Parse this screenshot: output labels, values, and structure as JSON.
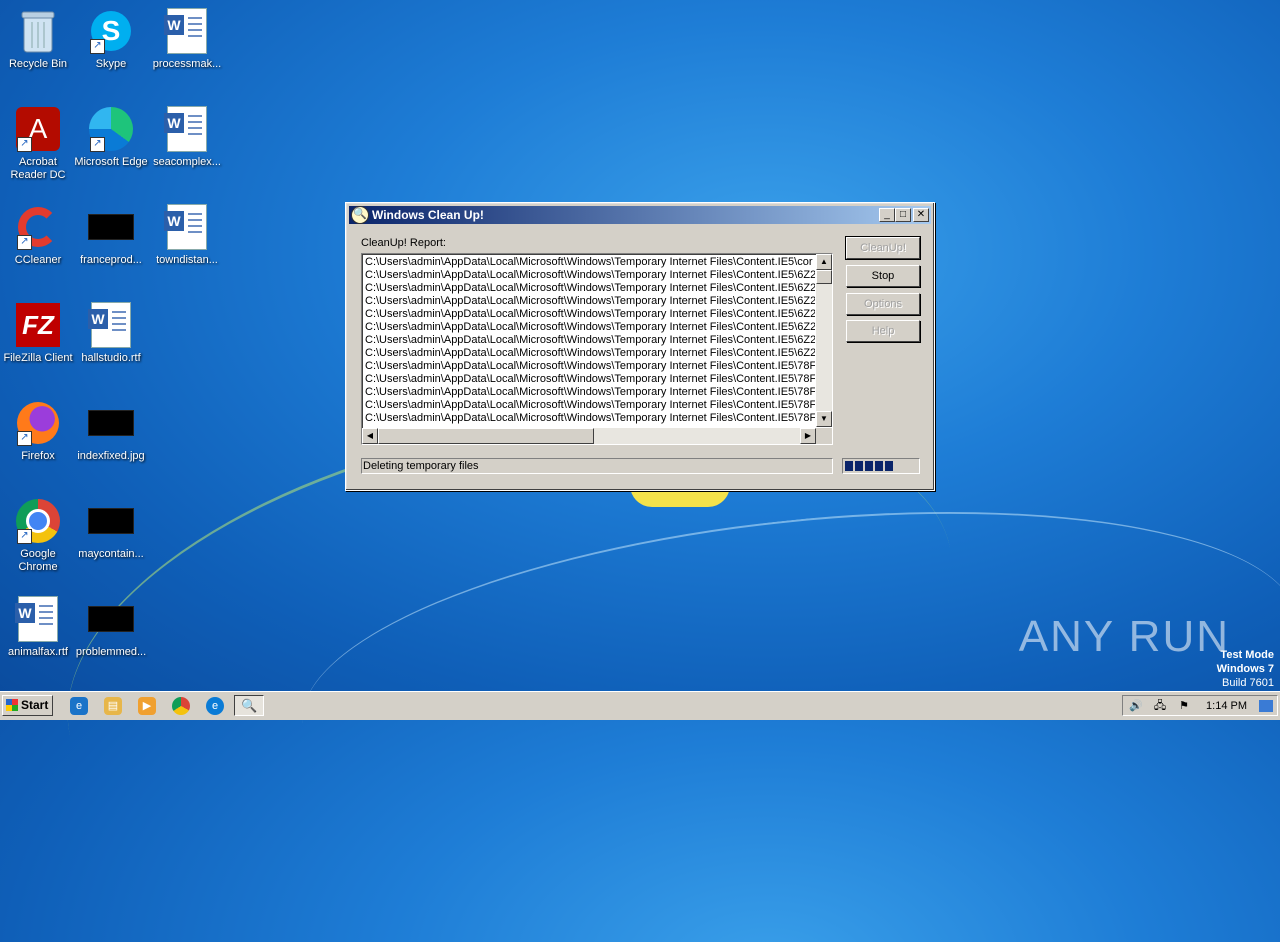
{
  "desktop": {
    "icons": [
      {
        "label": "Recycle Bin"
      },
      {
        "label": "Skype"
      },
      {
        "label": "processmak..."
      },
      {
        "label": "Acrobat Reader DC"
      },
      {
        "label": "Microsoft Edge"
      },
      {
        "label": "seacomplex..."
      },
      {
        "label": "CCleaner"
      },
      {
        "label": "franceprod..."
      },
      {
        "label": "towndistan..."
      },
      {
        "label": "FileZilla Client"
      },
      {
        "label": "hallstudio.rtf"
      },
      {
        "label": "Firefox"
      },
      {
        "label": "indexfixed.jpg"
      },
      {
        "label": "Google Chrome"
      },
      {
        "label": "maycontain..."
      },
      {
        "label": "animalfax.rtf"
      },
      {
        "label": "problemmed..."
      }
    ],
    "watermark": "ANY RUN",
    "test_mode": {
      "line1": "Test Mode",
      "line2": "Windows 7",
      "line3": "Build 7601"
    }
  },
  "window": {
    "title": "Windows Clean Up!",
    "report_label": "CleanUp! Report:",
    "rows": [
      "C:\\Users\\admin\\AppData\\Local\\Microsoft\\Windows\\Temporary Internet Files\\Content.IE5\\cor",
      "C:\\Users\\admin\\AppData\\Local\\Microsoft\\Windows\\Temporary Internet Files\\Content.IE5\\6Z2",
      "C:\\Users\\admin\\AppData\\Local\\Microsoft\\Windows\\Temporary Internet Files\\Content.IE5\\6Z2",
      "C:\\Users\\admin\\AppData\\Local\\Microsoft\\Windows\\Temporary Internet Files\\Content.IE5\\6Z2",
      "C:\\Users\\admin\\AppData\\Local\\Microsoft\\Windows\\Temporary Internet Files\\Content.IE5\\6Z2",
      "C:\\Users\\admin\\AppData\\Local\\Microsoft\\Windows\\Temporary Internet Files\\Content.IE5\\6Z2",
      "C:\\Users\\admin\\AppData\\Local\\Microsoft\\Windows\\Temporary Internet Files\\Content.IE5\\6Z2",
      "C:\\Users\\admin\\AppData\\Local\\Microsoft\\Windows\\Temporary Internet Files\\Content.IE5\\6Z2",
      "C:\\Users\\admin\\AppData\\Local\\Microsoft\\Windows\\Temporary Internet Files\\Content.IE5\\78F",
      "C:\\Users\\admin\\AppData\\Local\\Microsoft\\Windows\\Temporary Internet Files\\Content.IE5\\78F",
      "C:\\Users\\admin\\AppData\\Local\\Microsoft\\Windows\\Temporary Internet Files\\Content.IE5\\78F",
      "C:\\Users\\admin\\AppData\\Local\\Microsoft\\Windows\\Temporary Internet Files\\Content.IE5\\78F",
      "C:\\Users\\admin\\AppData\\Local\\Microsoft\\Windows\\Temporary Internet Files\\Content.IE5\\78F"
    ],
    "buttons": {
      "cleanup": "CleanUp!",
      "stop": "Stop",
      "options": "Options",
      "help": "Help"
    },
    "status_text": "Deleting temporary files",
    "progress_blocks": 5,
    "progress_fraction": 0.7
  },
  "taskbar": {
    "start_label": "Start",
    "clock": "1:14 PM"
  }
}
